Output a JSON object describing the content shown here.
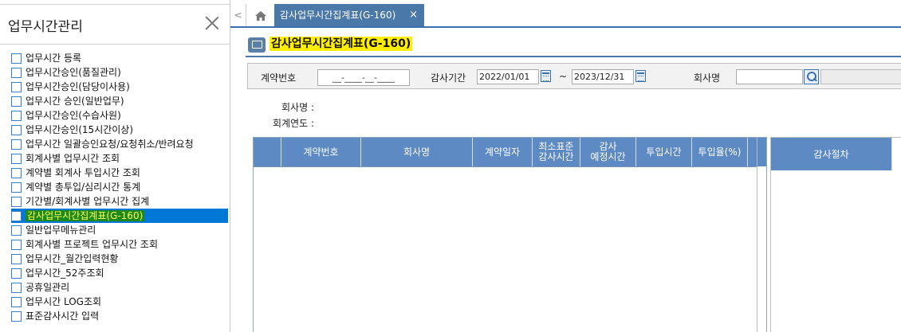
{
  "sidebar": {
    "title": "업무시간관리",
    "items": [
      {
        "label": "업무시간 등록"
      },
      {
        "label": "업무시간승인(품질관리)"
      },
      {
        "label": "업무시간승인(담당이사용)"
      },
      {
        "label": "업무시간 승인(일반업무)"
      },
      {
        "label": "업무시간승인(수습사원)"
      },
      {
        "label": "업무시간승인(15시간이상)"
      },
      {
        "label": "업무시간 일괄승인요청/요청취소/반려요청"
      },
      {
        "label": "회계사별 업무시간 조회"
      },
      {
        "label": "계약별 회계사 투입시간 조회"
      },
      {
        "label": "계약별 총투입/심리시간 통계"
      },
      {
        "label": "기간별/회계사별 업무시간 집계"
      },
      {
        "label": "감사업무시간집계표(G-160)"
      },
      {
        "label": "일반업무메뉴관리"
      },
      {
        "label": "회계사별 프로젝트 업무시간 조회"
      },
      {
        "label": "업무시간_월간입력현황"
      },
      {
        "label": "업무시간_52주조회"
      },
      {
        "label": "공휴일관리"
      },
      {
        "label": "업무시간 LOG조회"
      },
      {
        "label": "표준감사시간 입력"
      }
    ],
    "active_index": 11
  },
  "tabs": {
    "prev_glyph": "<",
    "home_glyph": "⌂",
    "active_label": "감사업무시간집계표(G-160)",
    "close_glyph": "×"
  },
  "page": {
    "title": "감사업무시간집계표(G-160)"
  },
  "search": {
    "contract_label": "계약번호",
    "contract_value": "__-____-__-____",
    "period_label": "감사기간",
    "date_from": "2022/01/01",
    "tilde": "~",
    "date_to": "2023/12/31",
    "company_label": "회사명",
    "company_value": ""
  },
  "info": {
    "company_label": "회사명 :",
    "fiscal_year_label": "회계연도 :"
  },
  "grid": {
    "columns": [
      {
        "label": ""
      },
      {
        "label": "계약번호"
      },
      {
        "label": "회사명"
      },
      {
        "label": "계약일자"
      },
      {
        "label": "최소표준\n감사시간"
      },
      {
        "label": "감사\n예정시간"
      },
      {
        "label": "투입시간"
      },
      {
        "label": "투입율(%)"
      }
    ],
    "rows": []
  },
  "grid2": {
    "header": "감사절차"
  }
}
